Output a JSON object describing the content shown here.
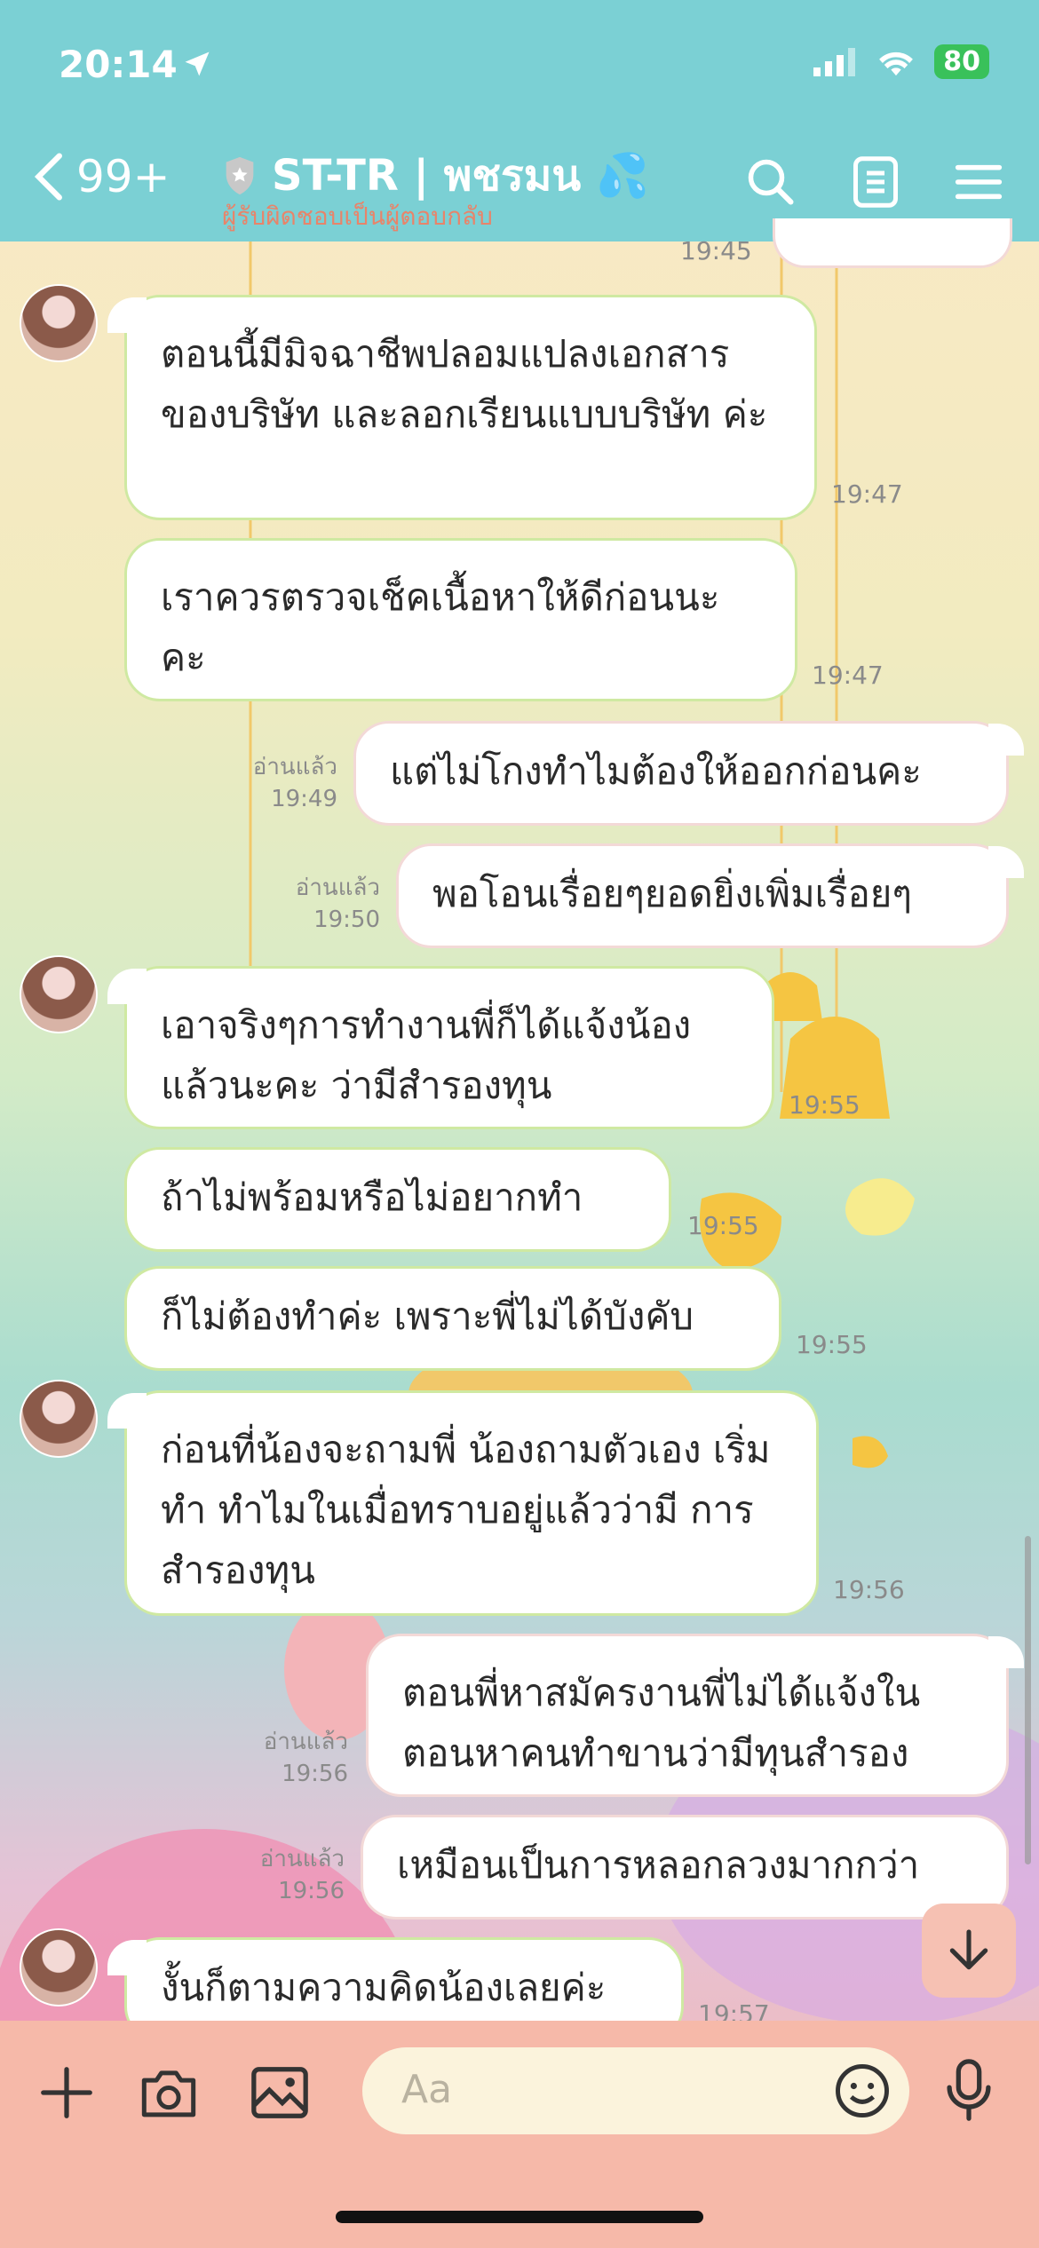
{
  "status": {
    "time": "20:14",
    "battery": "80"
  },
  "header": {
    "back_count": "99+",
    "title": "ST-TR | พชรมน 💦",
    "subtitle": "ผู้รับผิดชอบเป็นผู้ตอบกลับ"
  },
  "messages": [
    {
      "text": "19:45",
      "kind": "time-partial"
    },
    {
      "dir": "in",
      "text": "ตอนนี้มีมิจฉาชีพปลอมแปลงเอกสาร ของบริษัท และลอกเรียนแบบบริษัท ค่ะ",
      "time": "19:47"
    },
    {
      "dir": "in",
      "text": "เราควรตรวจเช็คเนื้อหาให้ดีก่อนนะ คะ",
      "time": "19:47"
    },
    {
      "dir": "out",
      "text": "แต่ไม่โกงทำไมต้องให้ออกก่อนคะ",
      "read": "อ่านแล้ว",
      "time": "19:49"
    },
    {
      "dir": "out",
      "text": "พอโอนเรื่อยๆยอดยิ่งเพิ่มเรื่อยๆ",
      "read": "อ่านแล้ว",
      "time": "19:50"
    },
    {
      "dir": "in",
      "text": "เอาจริงๆการทำงานพี่ก็ได้แจ้งน้อง แล้วนะคะ ว่ามีสำรองทุน",
      "time": "19:55"
    },
    {
      "dir": "in",
      "text": "ถ้าไม่พร้อมหรือไม่อยากทำ",
      "time": "19:55"
    },
    {
      "dir": "in",
      "text": "ก็ไม่ต้องทำค่ะ เพราะพี่ไม่ได้บังคับ",
      "time": "19:55"
    },
    {
      "dir": "in",
      "text": "ก่อนที่น้องจะถามพี่ น้องถามตัวเอง เริ่มทำ ทำไมในเมื่อทราบอยู่แล้วว่ามี การสำรองทุน",
      "time": "19:56"
    },
    {
      "dir": "out",
      "text": "ตอนพี่หาสมัครงานพี่ไม่ได้แจ้งใน ตอนหาคนทำขานว่ามีทุนสำรอง",
      "read": "อ่านแล้ว",
      "time": "19:56"
    },
    {
      "dir": "out",
      "text": "เหมือนเป็นการหลอกลวงมากกว่า",
      "read": "อ่านแล้ว",
      "time": "19:56"
    },
    {
      "dir": "in",
      "text": "งั้นก็ตามความคิดน้องเลยค่ะ",
      "time": "19:57"
    }
  ],
  "composer": {
    "placeholder": "Aa"
  },
  "colors": {
    "header": "#7bd0d4",
    "composer": "#f6b9a9",
    "in_border": "#cfe9a2"
  }
}
